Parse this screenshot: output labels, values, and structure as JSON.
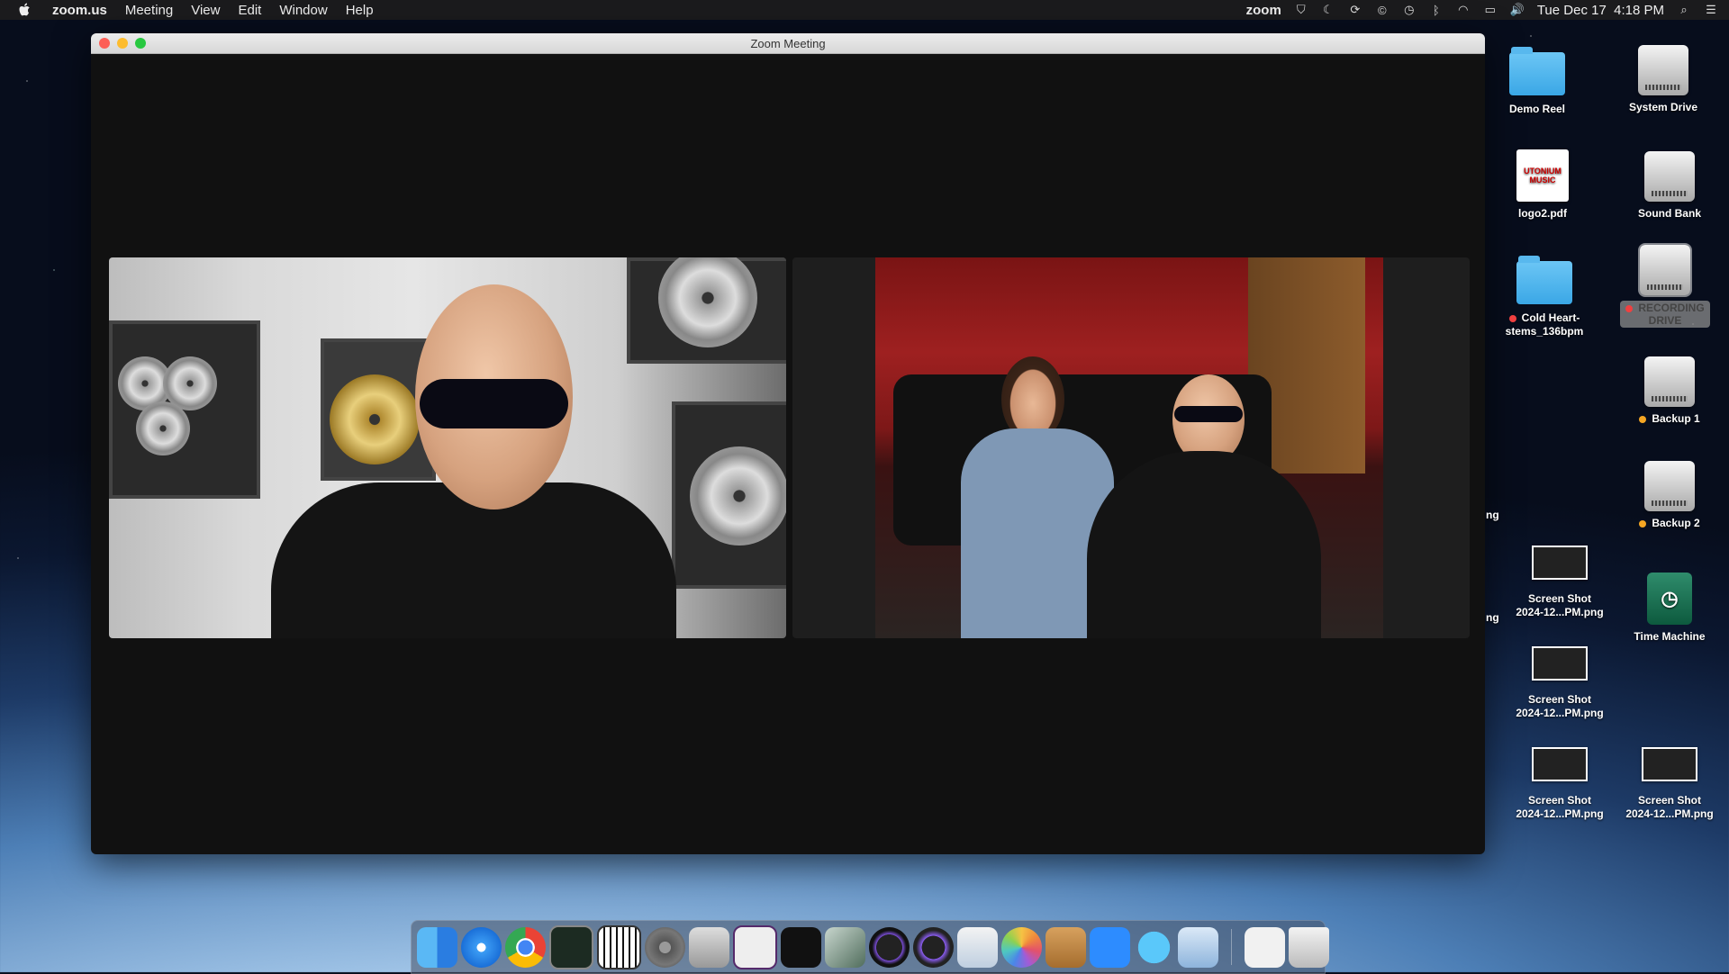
{
  "menubar": {
    "app_name": "zoom.us",
    "menus": [
      "Meeting",
      "View",
      "Edit",
      "Window",
      "Help"
    ],
    "status_app": "zoom",
    "clock": "Tue Dec 17  4:18 PM"
  },
  "window": {
    "title": "Zoom Meeting"
  },
  "desktop": {
    "demo_reel": "Demo Reel",
    "system_drive": "System Drive",
    "logo_pdf": "logo2.pdf",
    "sound_bank": "Sound Bank",
    "cold_heart_line1": "Cold Heart-",
    "cold_heart_line2": "stems_136bpm",
    "recording_drive_line1": "RECORDING",
    "recording_drive_line2": "DRIVE",
    "backup1": "Backup 1",
    "backup2": "Backup 2",
    "time_machine": "Time Machine",
    "shot_line1": "Screen Shot",
    "shot_line2": "2024-12...PM.png",
    "edge_text_1": "ng",
    "edge_text_2": "ng",
    "pdf_thumb_text": "UTONIUM MUSIC"
  },
  "colors": {
    "zoom_blue": "#2d8cff",
    "red_tag": "#f04040",
    "orange_tag": "#f5a623"
  }
}
